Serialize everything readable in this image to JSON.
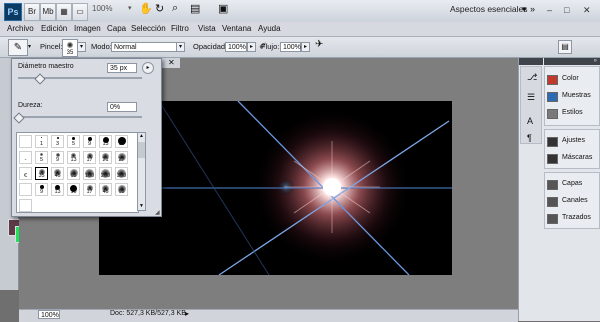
{
  "appbar": {
    "logo": "Ps",
    "zoom": "100%",
    "workspace": "Aspectos esenciales",
    "win_controls": [
      "–",
      "□",
      "✕"
    ]
  },
  "menu": [
    "Archivo",
    "Edición",
    "Imagen",
    "Capa",
    "Selección",
    "Filtro",
    "Vista",
    "Ventana",
    "Ayuda"
  ],
  "options": {
    "pincel_label": "Pincel:",
    "brush_size": "35",
    "modo_label": "Modo:",
    "modo_value": "Normal",
    "opacidad_label": "Opacidad:",
    "opacidad_value": "100%",
    "flujo_label": "Flujo:",
    "flujo_value": "100%"
  },
  "picker": {
    "diameter_label": "Diámetro maestro",
    "diameter_value": "35 px",
    "diameter_fraction": 0.17,
    "hardness_label": "Dureza:",
    "hardness_value": "0%",
    "hardness_fraction": 0.0,
    "brushes": [
      {
        "label": "1",
        "size": 1,
        "soft": false
      },
      {
        "label": "3",
        "size": 2,
        "soft": false
      },
      {
        "label": "5",
        "size": 3,
        "soft": false
      },
      {
        "label": "9",
        "size": 4,
        "soft": false
      },
      {
        "label": "13",
        "size": 6,
        "soft": false
      },
      {
        "label": "19",
        "size": 8,
        "soft": false
      },
      {
        "label": "5",
        "size": 3,
        "soft": true
      },
      {
        "label": "9",
        "size": 4,
        "soft": true
      },
      {
        "label": "13",
        "size": 5,
        "soft": true
      },
      {
        "label": "17",
        "size": 6,
        "soft": true
      },
      {
        "label": "21",
        "size": 7,
        "soft": true
      },
      {
        "label": "27",
        "size": 8,
        "soft": true
      },
      {
        "label": "35",
        "size": 6,
        "soft": true
      },
      {
        "label": "45",
        "size": 7,
        "soft": true
      },
      {
        "label": "65",
        "size": 8,
        "soft": true
      },
      {
        "label": "100",
        "size": 9,
        "soft": true
      },
      {
        "label": "200",
        "size": 9,
        "soft": true
      },
      {
        "label": "300",
        "size": 9,
        "soft": true
      },
      {
        "label": "9",
        "size": 4,
        "soft": false
      },
      {
        "label": "13",
        "size": 5,
        "soft": false
      },
      {
        "label": "19",
        "size": 7,
        "soft": false
      },
      {
        "label": "17",
        "size": 6,
        "soft": true
      },
      {
        "label": "45",
        "size": 7,
        "soft": true
      },
      {
        "label": "65",
        "size": 8,
        "soft": true
      }
    ],
    "brush_row_prefixes": [
      "",
      "-",
      "€",
      "",
      ""
    ]
  },
  "status": {
    "zoom": "100%",
    "doc": "Doc: 527,3 KB/527,3 KB"
  },
  "panels": [
    {
      "label": "Color",
      "icon": "color-icon",
      "color": "#c0392b"
    },
    {
      "label": "Muestras",
      "icon": "swatches-icon",
      "color": "#2d6cb3"
    },
    {
      "label": "Estilos",
      "icon": "styles-icon",
      "color": "#7a7a7a"
    },
    {
      "label": "Ajustes",
      "icon": "adjustments-icon",
      "color": "#333333"
    },
    {
      "label": "Máscaras",
      "icon": "masks-icon",
      "color": "#333333"
    },
    {
      "label": "Capas",
      "icon": "layers-icon",
      "color": "#555555"
    },
    {
      "label": "Canales",
      "icon": "channels-icon",
      "color": "#555555"
    },
    {
      "label": "Trazados",
      "icon": "paths-icon",
      "color": "#555555"
    }
  ],
  "colors": {
    "foreground": "#5c3a47",
    "background": "#1ee25a"
  }
}
